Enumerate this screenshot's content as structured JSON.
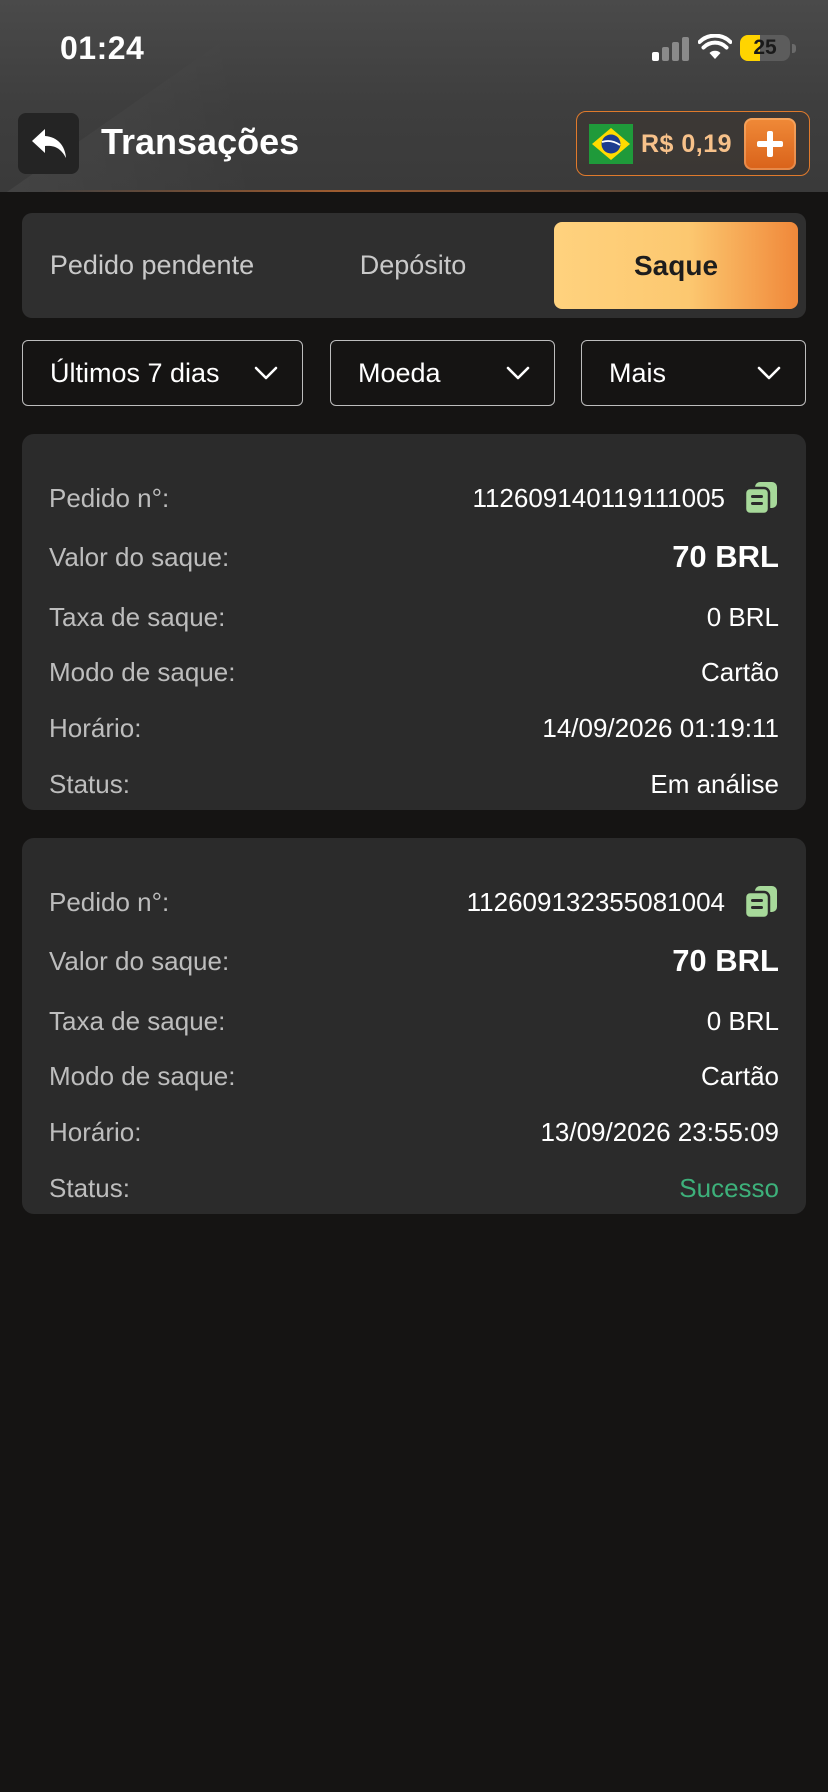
{
  "status_bar": {
    "time": "01:24",
    "battery": "25"
  },
  "header": {
    "title": "Transações",
    "balance": "R$ 0,19"
  },
  "tabs": [
    {
      "label": "Pedido pendente"
    },
    {
      "label": "Depósito"
    },
    {
      "label": "Saque"
    }
  ],
  "active_tab": "Saque",
  "filters": {
    "period": "Últimos 7 dias",
    "currency": "Moeda",
    "more": "Mais"
  },
  "labels": {
    "order": "Pedido n°:",
    "amount": "Valor do saque:",
    "fee": "Taxa de saque:",
    "mode": "Modo de saque:",
    "time": "Horário:",
    "status": "Status:"
  },
  "transactions": [
    {
      "order_id": "112609140119111005",
      "amount": "70 BRL",
      "fee": "0 BRL",
      "mode": "Cartão",
      "time": "14/09/2026 01:19:11",
      "status": "Em análise"
    },
    {
      "order_id": "112609132355081004",
      "amount": "70 BRL",
      "fee": "0 BRL",
      "mode": "Cartão",
      "time": "13/09/2026 23:55:09",
      "status": "Sucesso"
    }
  ],
  "colors": {
    "accent_orange": "#f08a38",
    "tab_active_start": "#ffd27e",
    "success_green": "#3db07a",
    "copy_icon": "#a7d99a"
  },
  "icons": {
    "back": "back-arrow-icon",
    "add": "plus-icon",
    "flag": "brazil-flag-icon",
    "copy": "copy-icon",
    "dropdown": "chevron-down-icon"
  }
}
